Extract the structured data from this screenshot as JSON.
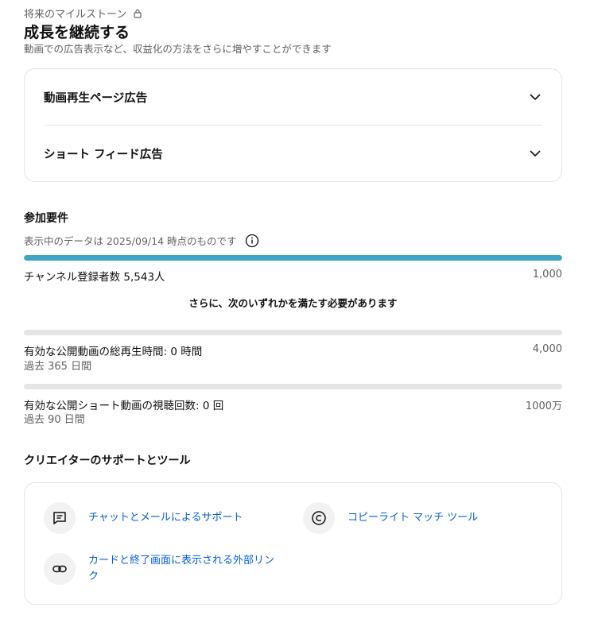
{
  "header": {
    "eyebrow": "将来のマイルストーン",
    "title": "成長を継続する",
    "subtitle": "動画での広告表示など、収益化の方法をさらに増やすことができます"
  },
  "ads": {
    "items": [
      {
        "label": "動画再生ページ広告"
      },
      {
        "label": "ショート フィード広告"
      }
    ]
  },
  "requirements": {
    "heading": "参加要件",
    "as_of": "表示中のデータは 2025/09/14 時点のものです",
    "subscribers": {
      "label": "チャンネル登録者数 5,543人",
      "target": "1,000",
      "progress": 1.0
    },
    "note": "さらに、次のいずれかを満たす必要があります",
    "watch_time": {
      "label": "有効な公開動画の総再生時間: 0 時間",
      "sub": "過去 365 日間",
      "target": "4,000",
      "progress": 0.0
    },
    "shorts_views": {
      "label": "有効な公開ショート動画の視聴回数: 0 回",
      "sub": "過去 90 日間",
      "target": "1000万",
      "progress": 0.0
    }
  },
  "tools": {
    "heading": "クリエイターのサポートとツール",
    "items": [
      {
        "label": "チャットとメールによるサポート",
        "icon": "chat-icon"
      },
      {
        "label": "コピーライト マッチ ツール",
        "icon": "copyright-icon"
      },
      {
        "label": "カードと終了画面に表示される外部リンク",
        "icon": "link-icon"
      }
    ]
  },
  "colors": {
    "accent": "#3ea6c4",
    "link": "#065fd4",
    "track": "#e5e5e5"
  }
}
